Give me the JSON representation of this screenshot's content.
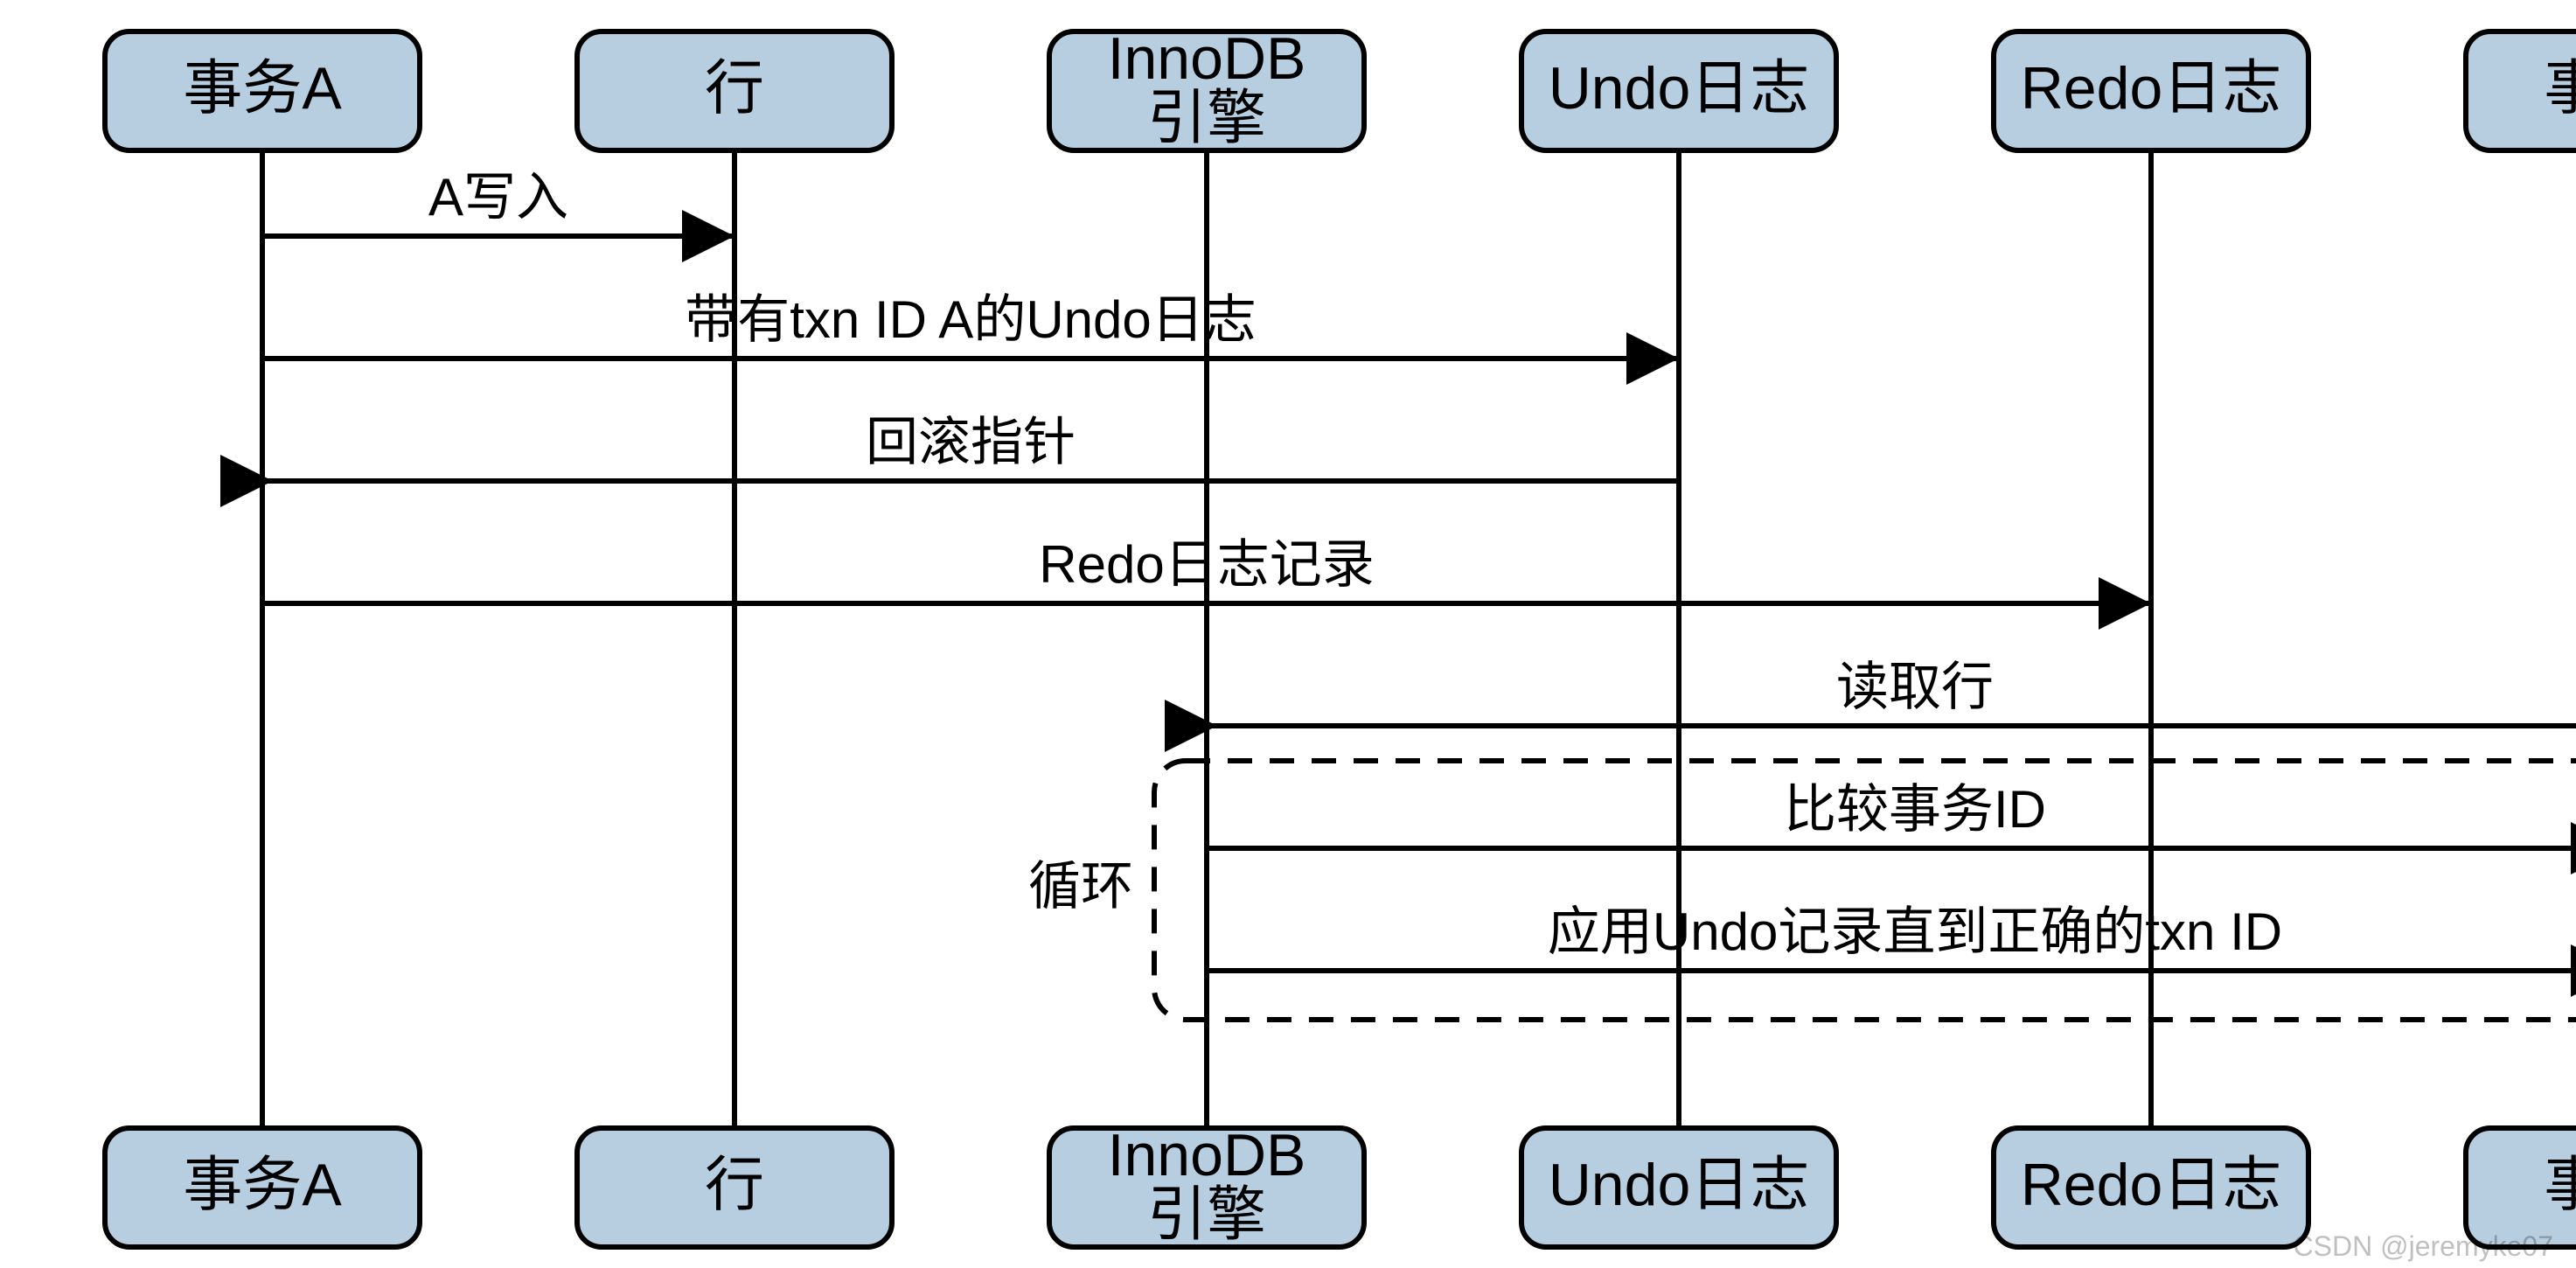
{
  "chart_data": {
    "type": "sequence",
    "participants": [
      {
        "id": "txA",
        "label": "事务A"
      },
      {
        "id": "row",
        "label": "行"
      },
      {
        "id": "innodb",
        "label": "InnoDB\n引擎"
      },
      {
        "id": "undo",
        "label": "Undo日志"
      },
      {
        "id": "redo",
        "label": "Redo日志"
      },
      {
        "id": "txB",
        "label": "事务B"
      }
    ],
    "messages": [
      {
        "from": "txA",
        "to": "row",
        "label": "A写入"
      },
      {
        "from": "txA",
        "to": "undo",
        "label": "带有txn ID A的Undo日志"
      },
      {
        "from": "undo",
        "to": "txA",
        "label": "回滚指针"
      },
      {
        "from": "txA",
        "to": "redo",
        "label": "Redo日志记录"
      },
      {
        "from": "txB",
        "to": "innodb",
        "label": "读取行"
      },
      {
        "from": "innodb",
        "to": "txB",
        "label": "比较事务ID",
        "group": "loop1"
      },
      {
        "from": "innodb",
        "to": "txB",
        "label": "应用Undo记录直到正确的txn ID",
        "group": "loop1"
      }
    ],
    "groups": [
      {
        "id": "loop1",
        "kind": "loop",
        "label": "循环"
      }
    ]
  },
  "watermark": "CSDN @jeremyke07"
}
